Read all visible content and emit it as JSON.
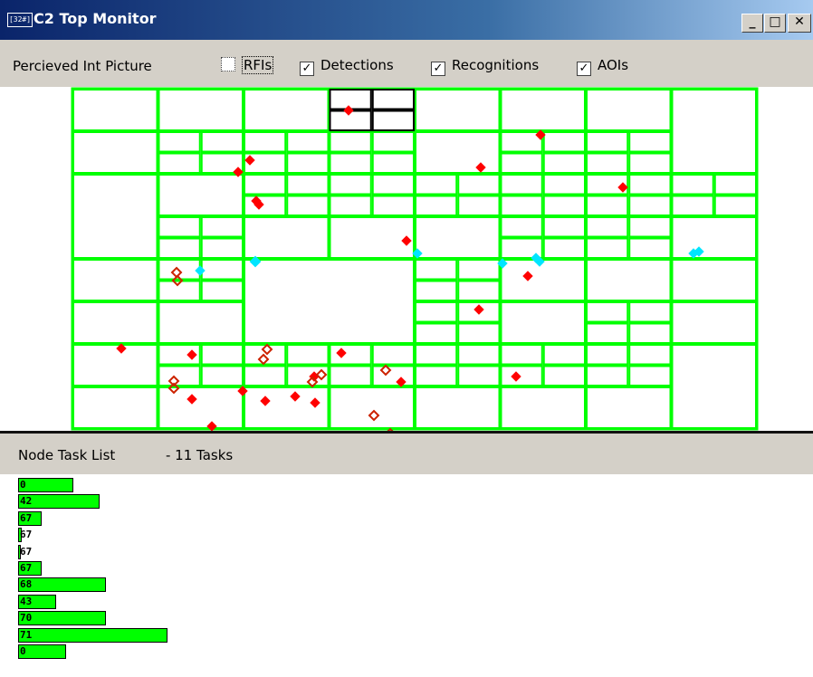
{
  "window": {
    "icon_label": "[32#]",
    "title": "C2 Top Monitor"
  },
  "window_buttons": {
    "minimize": "_",
    "maximize": "□",
    "close": "✕"
  },
  "toolbar": {
    "label": "Percieved Int Picture",
    "checkboxes": [
      {
        "label": "RFIs",
        "checked": false
      },
      {
        "label": "Detections",
        "checked": true
      },
      {
        "label": "Recognitions",
        "checked": true
      },
      {
        "label": "AOIs",
        "checked": true
      }
    ]
  },
  "map": {
    "colors": {
      "grid": "#00ff00",
      "selected_cell": "#000000",
      "detection": "#ff0000",
      "recognition": "#cc2200",
      "cyan": "#00e5ff"
    },
    "marker_legend": [
      "detection: filled red diamond",
      "recognition: hollow red diamond",
      "cyan diamond"
    ]
  },
  "task_panel": {
    "title": "Node Task List",
    "count_label": "- 11 Tasks",
    "tasks": [
      {
        "value": "0",
        "fill": 0.27
      },
      {
        "value": "42",
        "fill": 0.4
      },
      {
        "value": "67",
        "fill": 0.11
      },
      {
        "value": "67",
        "fill": 0.01
      },
      {
        "value": "67",
        "fill": 0.005
      },
      {
        "value": "67",
        "fill": 0.11
      },
      {
        "value": "68",
        "fill": 0.43
      },
      {
        "value": "43",
        "fill": 0.18
      },
      {
        "value": "70",
        "fill": 0.43
      },
      {
        "value": "71",
        "fill": 0.74
      },
      {
        "value": "0",
        "fill": 0.23
      }
    ]
  }
}
